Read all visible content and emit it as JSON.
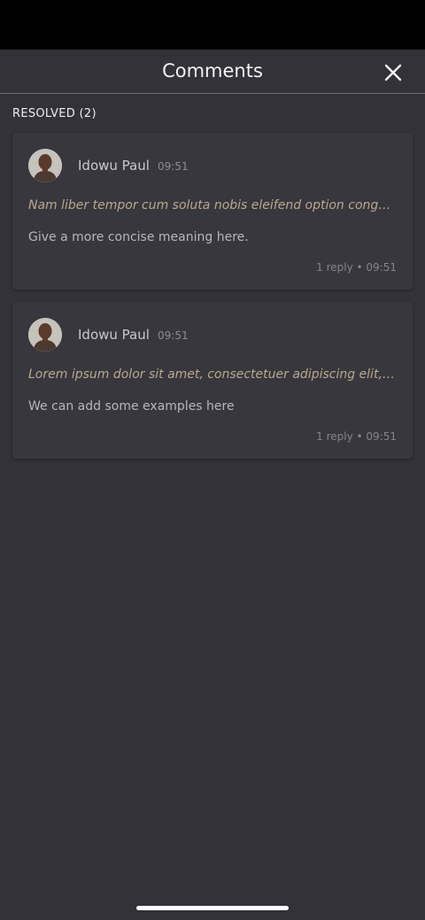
{
  "header": {
    "title": "Comments",
    "close_icon": "close-icon"
  },
  "section": {
    "label": "RESOLVED (2)"
  },
  "comments": [
    {
      "author": "Idowu Paul",
      "time": "09:51",
      "quote": "Nam liber tempor cum soluta nobis eleifend option congue nihil imperdiet doming id quod mazim placerat facer possim assum.",
      "text": "Give a more concise meaning here.",
      "meta": "1 reply • 09:51"
    },
    {
      "author": "Idowu Paul",
      "time": "09:51",
      "quote": "Lorem ipsum dolor sit amet, consectetuer adipiscing elit, sed diam nonummy nibh euismod tincidunt ut laoreet dolore magna.",
      "text": "We can add some examples here",
      "meta": "1 reply • 09:51"
    }
  ],
  "colors": {
    "background": "#333238",
    "card": "#38373d",
    "quote": "#b9a88e"
  }
}
